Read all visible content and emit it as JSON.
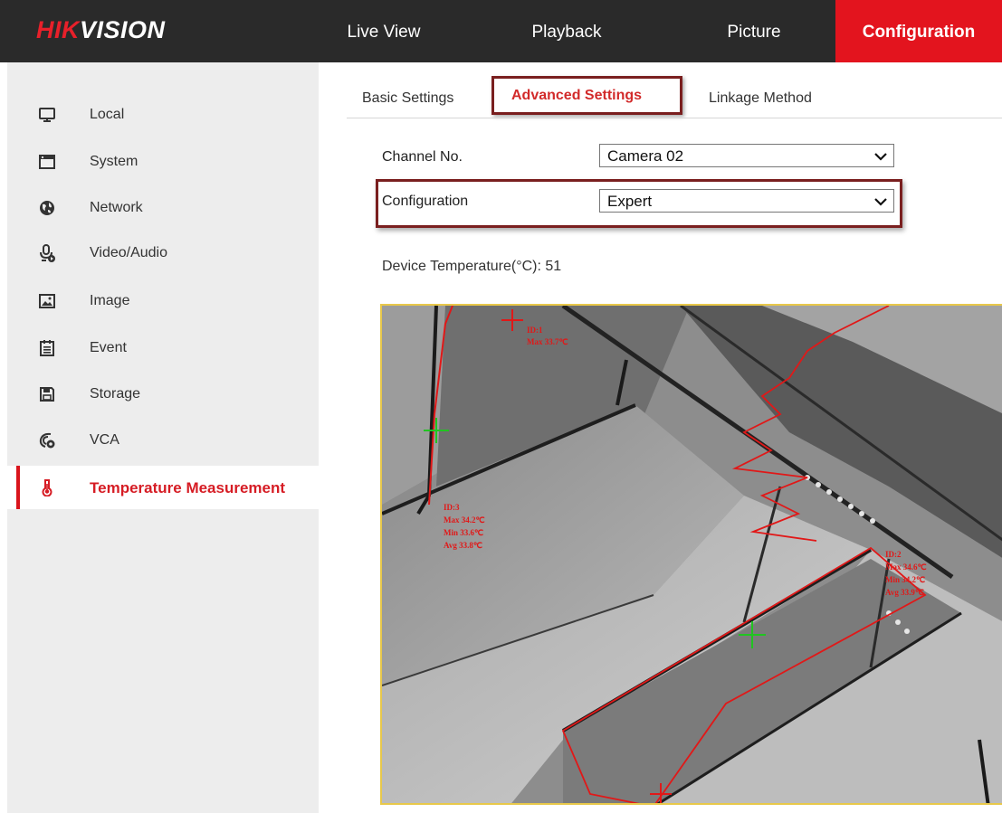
{
  "brand": {
    "logo_red": "HIK",
    "logo_white": "VISION"
  },
  "nav": {
    "items": [
      {
        "label": "Live View"
      },
      {
        "label": "Playback"
      },
      {
        "label": "Picture"
      },
      {
        "label": "Configuration"
      }
    ],
    "active": "Configuration"
  },
  "sidebar": {
    "items": [
      {
        "label": "Local",
        "icon": "monitor-icon"
      },
      {
        "label": "System",
        "icon": "system-window-icon"
      },
      {
        "label": "Network",
        "icon": "globe-icon"
      },
      {
        "label": "Video/Audio",
        "icon": "microphone-icon"
      },
      {
        "label": "Image",
        "icon": "image-icon"
      },
      {
        "label": "Event",
        "icon": "calendar-icon"
      },
      {
        "label": "Storage",
        "icon": "floppy-disk-icon"
      },
      {
        "label": "VCA",
        "icon": "vca-icon"
      },
      {
        "label": "Temperature Measurement",
        "icon": "thermometer-icon"
      }
    ],
    "active": "Temperature Measurement"
  },
  "tabs": {
    "items": [
      {
        "label": "Basic Settings"
      },
      {
        "label": "Advanced Settings"
      },
      {
        "label": "Linkage Method"
      }
    ],
    "active": "Advanced Settings"
  },
  "form": {
    "channel_label": "Channel No.",
    "channel_value": "Camera 02",
    "config_label": "Configuration",
    "config_value": "Expert",
    "device_temp_label": "Device Temperature(°C):",
    "device_temp_value": "51"
  },
  "thermal_view": {
    "regions": [
      {
        "id": "ID:3",
        "max": "Max 34.2℃",
        "min": "Min 33.6℃",
        "avg": "Avg 33.8℃"
      },
      {
        "id": "ID:2",
        "max": "Max 34.6℃",
        "min": "Min 34.2℃",
        "avg": "Avg 33.9℃"
      },
      {
        "id": "ID:1",
        "min": "Max 33.7℃"
      }
    ]
  },
  "colors": {
    "accent_red": "#e3141e",
    "topbar": "#2a2a2a",
    "sidebar_bg": "#ededed",
    "highlight_border": "#7a1f1f",
    "overlay_red": "#e11818",
    "marker_green": "#21c421",
    "image_border": "#e8c84a"
  }
}
